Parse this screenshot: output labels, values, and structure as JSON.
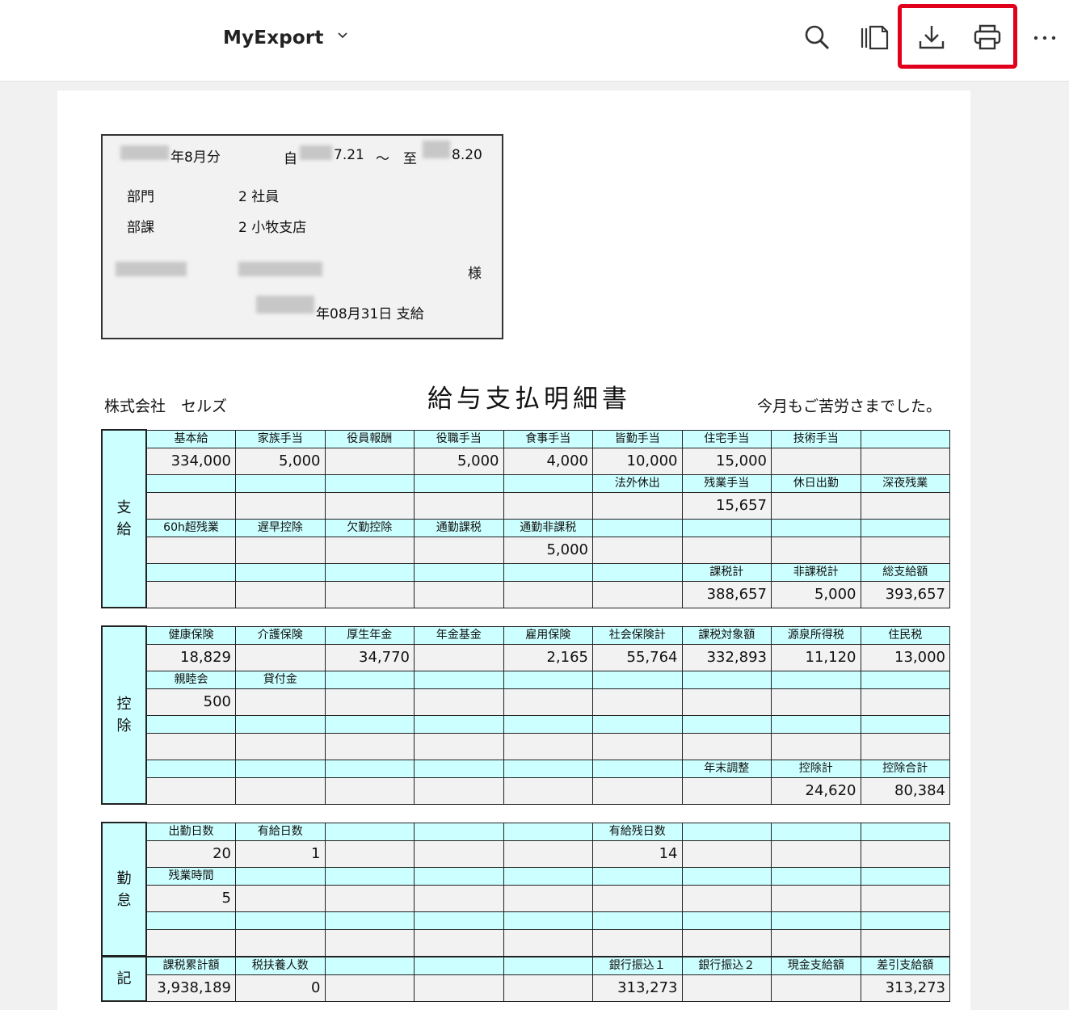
{
  "toolbar": {
    "title": "MyExport",
    "icons": [
      "chevron-down-icon",
      "search-icon",
      "page-thumbnails-icon",
      "download-icon",
      "print-icon",
      "more-options-icon"
    ],
    "highlight_color": "#e0001b"
  },
  "header": {
    "period_month": "年8月分",
    "from_label": "自",
    "from_date": "7.21",
    "tilde": "～",
    "to_label": "至",
    "to_date": "8.20",
    "dept_label": "部門",
    "dept_value": "2 社員",
    "section_label": "部課",
    "section_value": "2 小牧支店",
    "honorific": "様",
    "pay_date": "年08月31日 支給"
  },
  "company": "株式会社　セルズ",
  "heading": "給与支払明細書",
  "greeting": "今月もご苦労さまでした。",
  "colors": {
    "label_bg": "#ccffff",
    "value_bg": "#f2f2f2",
    "border": "#222222"
  },
  "sections": {
    "payments": {
      "side_label": [
        "支",
        "給"
      ],
      "rows": [
        [
          "基本給",
          "家族手当",
          "役員報酬",
          "役職手当",
          "食事手当",
          "皆勤手当",
          "住宅手当",
          "技術手当",
          ""
        ],
        [
          "334,000",
          "5,000",
          "",
          "5,000",
          "4,000",
          "10,000",
          "15,000",
          "",
          ""
        ],
        [
          "",
          "",
          "",
          "",
          "",
          "法外休出",
          "残業手当",
          "休日出勤",
          "深夜残業"
        ],
        [
          "",
          "",
          "",
          "",
          "",
          "",
          "15,657",
          "",
          ""
        ],
        [
          "60h超残業",
          "遅早控除",
          "欠勤控除",
          "通勤課税",
          "通勤非課税",
          "",
          "",
          "",
          ""
        ],
        [
          "",
          "",
          "",
          "",
          "5,000",
          "",
          "",
          "",
          ""
        ],
        [
          "",
          "",
          "",
          "",
          "",
          "",
          "課税計",
          "非課税計",
          "総支給額"
        ],
        [
          "",
          "",
          "",
          "",
          "",
          "",
          "388,657",
          "5,000",
          "393,657"
        ]
      ]
    },
    "deductions": {
      "side_label": [
        "控",
        "除"
      ],
      "rows": [
        [
          "健康保険",
          "介護保険",
          "厚生年金",
          "年金基金",
          "雇用保険",
          "社会保険計",
          "課税対象額",
          "源泉所得税",
          "住民税"
        ],
        [
          "18,829",
          "",
          "34,770",
          "",
          "2,165",
          "55,764",
          "332,893",
          "11,120",
          "13,000"
        ],
        [
          "親睦会",
          "貸付金",
          "",
          "",
          "",
          "",
          "",
          "",
          ""
        ],
        [
          "500",
          "",
          "",
          "",
          "",
          "",
          "",
          "",
          ""
        ],
        [
          "",
          "",
          "",
          "",
          "",
          "",
          "",
          "",
          ""
        ],
        [
          "",
          "",
          "",
          "",
          "",
          "",
          "",
          "",
          ""
        ],
        [
          "",
          "",
          "",
          "",
          "",
          "",
          "年末調整",
          "控除計",
          "控除合計"
        ],
        [
          "",
          "",
          "",
          "",
          "",
          "",
          "",
          "24,620",
          "80,384"
        ]
      ]
    },
    "attendance": {
      "side_label": [
        "勤",
        "怠"
      ],
      "rows": [
        [
          "出勤日数",
          "有給日数",
          "",
          "",
          "",
          "有給残日数",
          "",
          "",
          ""
        ],
        [
          "20",
          "1",
          "",
          "",
          "",
          "14",
          "",
          "",
          ""
        ],
        [
          "残業時間",
          "",
          "",
          "",
          "",
          "",
          "",
          "",
          ""
        ],
        [
          "5",
          "",
          "",
          "",
          "",
          "",
          "",
          "",
          ""
        ],
        [
          "",
          "",
          "",
          "",
          "",
          "",
          "",
          "",
          ""
        ],
        [
          "",
          "",
          "",
          "",
          "",
          "",
          "",
          "",
          ""
        ]
      ]
    },
    "notes": {
      "side_label": [
        "記"
      ],
      "rows": [
        [
          "課税累計額",
          "税扶養人数",
          "",
          "",
          "",
          "銀行振込１",
          "銀行振込２",
          "現金支給額",
          "差引支給額"
        ],
        [
          "3,938,189",
          "0",
          "",
          "",
          "",
          "313,273",
          "",
          "",
          "313,273"
        ]
      ]
    }
  }
}
